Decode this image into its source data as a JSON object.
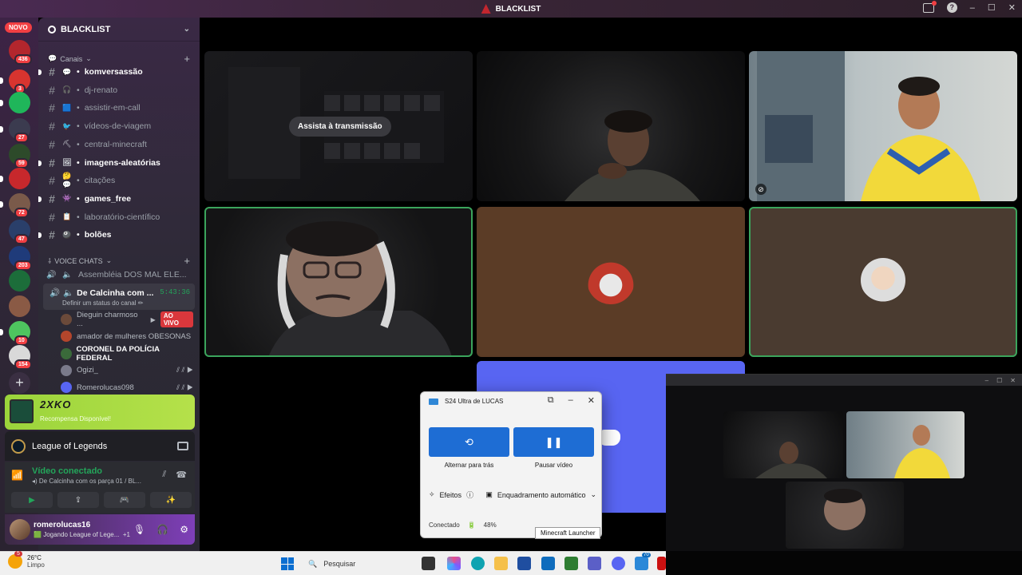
{
  "window": {
    "title": "BLACKLIST"
  },
  "rail": {
    "novo_label": "NOVO",
    "servers": [
      {
        "badge": "436",
        "color": "#b3262d"
      },
      {
        "badge": "3",
        "color": "#d8342f"
      },
      {
        "badge": "",
        "color": "#1fb65a"
      },
      {
        "badge": "27",
        "color": "#3b3b4f"
      },
      {
        "badge": "59",
        "color": "#2d4a2a"
      },
      {
        "badge": "",
        "color": "#c7282c"
      },
      {
        "badge": "72",
        "color": "#7a5a4a"
      },
      {
        "badge": "47",
        "color": "#2a3f6a"
      },
      {
        "badge": "203",
        "color": "#1f3b7a"
      },
      {
        "badge": "",
        "color": "#1c6d3a"
      },
      {
        "badge": "",
        "color": "#8a5a45"
      },
      {
        "badge": "10",
        "color": "#4ec45f"
      },
      {
        "badge": "154",
        "color": "#d9d9d9"
      }
    ]
  },
  "sidebar": {
    "guild_name": "BLACKLIST",
    "text_category": "Canais",
    "channels": [
      {
        "emoji": "💬",
        "name": "komversassão",
        "unread": true
      },
      {
        "emoji": "🎧",
        "name": "dj-renato",
        "unread": false
      },
      {
        "emoji": "🟦",
        "name": "assistir-em-call",
        "unread": false
      },
      {
        "emoji": "🐦",
        "name": "vídeos-de-viagem",
        "unread": false
      },
      {
        "emoji": "⛏",
        "name": "central-minecraft",
        "unread": false
      },
      {
        "emoji": "🖼",
        "name": "imagens-aleatórias",
        "unread": true
      },
      {
        "emoji": "🤔💬",
        "name": "citações",
        "unread": false
      },
      {
        "emoji": "👾",
        "name": "games_free",
        "unread": true
      },
      {
        "emoji": "📋",
        "name": "laboratório-científico",
        "unread": false
      },
      {
        "emoji": "🎱",
        "name": "bolões",
        "unread": true
      }
    ],
    "voice_category": "VOICE CHATS",
    "voice_channels": [
      {
        "name": "Assembléia DOS MAL ELE..."
      }
    ],
    "active_voice": {
      "name": "De Calcinha com ...",
      "time": "5:43:36",
      "status": "Definir um status do canal ✏"
    },
    "members": [
      {
        "name": "Dieguin charmoso ...",
        "live": "AO VIVO",
        "color": "#6b4a3a",
        "bold": false
      },
      {
        "name": "amador de mulheres OBESONAS",
        "live": "",
        "color": "#b4462c",
        "bold": false
      },
      {
        "name": "CORONEL DA POLÍCIA FEDERAL",
        "live": "",
        "color": "#3a6a3a",
        "bold": true
      },
      {
        "name": "Ogizi_",
        "live": "",
        "color": "#7a7a8a",
        "bold": false
      },
      {
        "name": "Romerolucas098",
        "live": "",
        "color": "#5865f2",
        "bold": false
      }
    ]
  },
  "promo": {
    "logo": "2XKO",
    "subtitle": "Recompensa Disponível!"
  },
  "activity": {
    "game": "League of Legends"
  },
  "voice": {
    "title": "Vídeo conectado",
    "subtitle": "De Calcinha com os parça 01 / BL...",
    "buttons": [
      "▶",
      "⇪",
      "🎮",
      "✨"
    ]
  },
  "user": {
    "name": "romerolucas16",
    "status": "Jogando League of Lege...",
    "extra": "+1"
  },
  "stream": {
    "watch_label": "Assista à transmissão"
  },
  "phone_link": {
    "title": "S24 Ultra de LUCAS",
    "btn_switch": "Alternar para trás",
    "btn_pause": "Pausar vídeo",
    "effects": "Efeitos",
    "framing": "Enquadramento automático",
    "connected": "Conectado",
    "battery": "48%",
    "tooltip": "Minecraft Launcher"
  },
  "taskbar": {
    "temperature": "26°C",
    "condition": "Limpo",
    "weather_badge": "5",
    "search_placeholder": "Pesquisar",
    "teams_badge": "70"
  }
}
